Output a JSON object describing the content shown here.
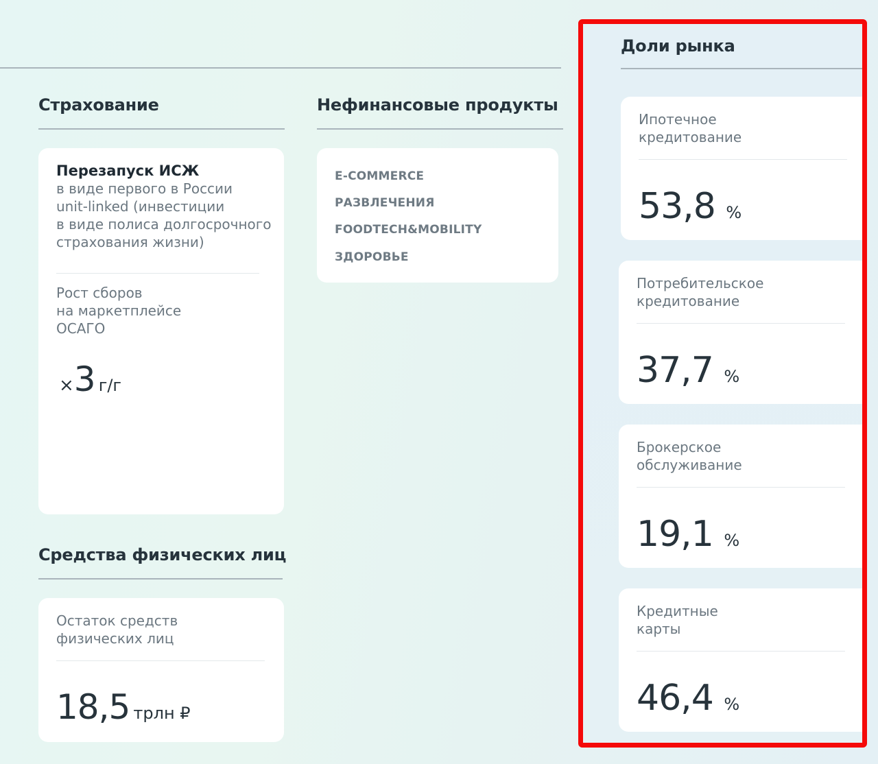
{
  "insurance": {
    "title": "Страхование",
    "card_title": "Перезапуск ИСЖ",
    "desc_lines": [
      "в виде первого в России",
      "unit-linked (инвестиции",
      "в виде полиса долгосрочного",
      "страхования жизни)"
    ],
    "metric_label_lines": [
      "Рост сборов",
      "на маркетплейсе",
      "ОСАГО"
    ],
    "metric_prefix": "×",
    "metric_value": "3",
    "metric_unit": "г/г"
  },
  "nonfinancial": {
    "title": "Нефинансовые продукты",
    "items": [
      "E-COMMERCE",
      "РАЗВЛЕЧЕНИЯ",
      "FOODTECH&MOBILITY",
      "ЗДОРОВЬЕ"
    ]
  },
  "individuals": {
    "title": "Средства физических лиц",
    "label_lines": [
      "Остаток средств",
      "физических лиц"
    ],
    "value": "18,5",
    "unit": "трлн ₽"
  },
  "market_share": {
    "title": "Доли рынка",
    "items": [
      {
        "label_lines": [
          "Ипотечное",
          "кредитование"
        ],
        "value": "53,8",
        "unit": "%"
      },
      {
        "label_lines": [
          "Потребительское",
          "кредитование"
        ],
        "value": "37,7",
        "unit": "%"
      },
      {
        "label_lines": [
          "Брокерское",
          "обслуживание"
        ],
        "value": "19,1",
        "unit": "%"
      },
      {
        "label_lines": [
          "Кредитные",
          "карты"
        ],
        "value": "46,4",
        "unit": "%"
      }
    ]
  },
  "colors": {
    "highlight": "#f50a0a",
    "text_dark": "#27333b",
    "text_muted": "#6b7780"
  }
}
